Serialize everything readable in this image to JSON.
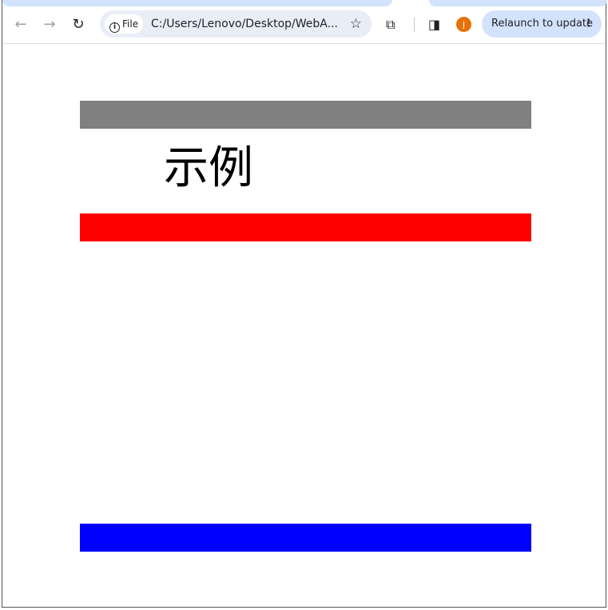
{
  "browser": {
    "back_icon": "arrow-left-icon",
    "forward_icon": "arrow-right-icon",
    "reload_icon": "reload-icon",
    "site_info_label": "File",
    "url": "C:/Users/Lenovo/Desktop/WebA...",
    "bookmark_icon": "star-icon",
    "extensions_icon": "puzzle-icon",
    "side_panel_icon": "side-panel-icon",
    "profile_initial": "j",
    "relaunch_label": "Relaunch to update",
    "menu_icon": "kebab-menu-icon"
  },
  "page": {
    "heading": "示例",
    "bars": [
      {
        "color": "#808080"
      },
      {
        "color": "#ff0000"
      },
      {
        "color": "#0000ff"
      }
    ]
  }
}
